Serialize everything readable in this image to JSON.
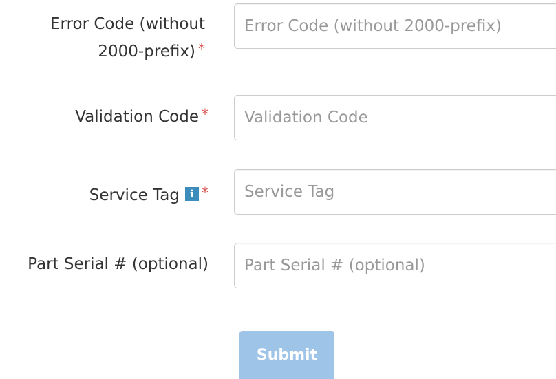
{
  "form": {
    "error_code": {
      "label_line1": "Error Code (without",
      "label_line2": "2000-prefix)",
      "required_mark": "*",
      "placeholder": "Error Code (without 2000-prefix)",
      "value": ""
    },
    "validation_code": {
      "label": "Validation Code",
      "required_mark": "*",
      "placeholder": "Validation Code",
      "value": ""
    },
    "service_tag": {
      "label": "Service Tag",
      "info_icon_glyph": "i",
      "info_icon": "info-icon",
      "required_mark": "*",
      "placeholder": "Service Tag",
      "value": ""
    },
    "part_serial": {
      "label": "Part Serial # (optional)",
      "placeholder": "Part Serial # (optional)",
      "value": ""
    },
    "submit_label": "Submit",
    "state": {
      "submit_disabled": true
    }
  },
  "colors": {
    "label_text": "#333333",
    "placeholder_text": "#999999",
    "required_mark": "#d9534f",
    "info_icon_bg": "#3c8dbc",
    "input_border": "#cccccc",
    "submit_bg": "#9ec5e8",
    "submit_text": "#ffffff"
  }
}
